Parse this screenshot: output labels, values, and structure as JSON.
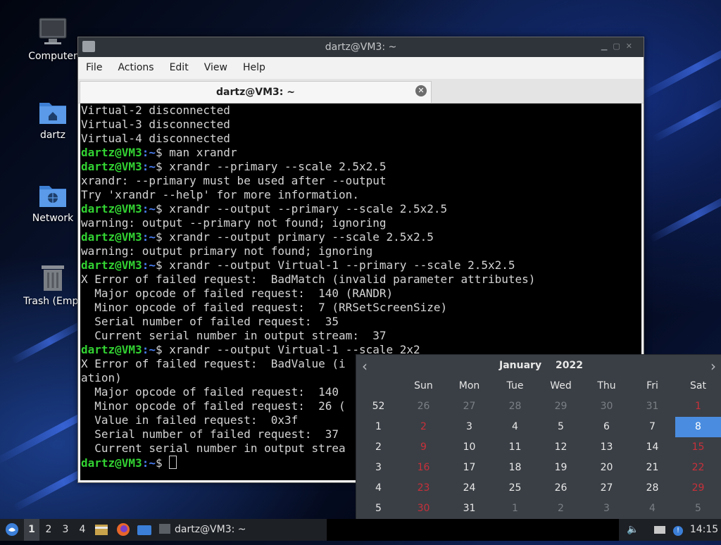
{
  "desktop": {
    "icons": [
      {
        "label": "Computer",
        "icon": "monitor-icon"
      },
      {
        "label": "dartz",
        "icon": "home-folder-icon"
      },
      {
        "label": "Network",
        "icon": "network-folder-icon"
      },
      {
        "label": "Trash (Empt",
        "icon": "trash-icon"
      }
    ]
  },
  "window": {
    "title": "dartz@VM3: ~",
    "menu": [
      "File",
      "Actions",
      "Edit",
      "View",
      "Help"
    ],
    "tab_title": "dartz@VM3: ~"
  },
  "terminal": {
    "prompt_user": "dartz@VM3",
    "prompt_path": ":~",
    "prompt_symbol": "$",
    "lines": [
      {
        "type": "out",
        "text": "Virtual-2 disconnected"
      },
      {
        "type": "out",
        "text": "Virtual-3 disconnected"
      },
      {
        "type": "out",
        "text": "Virtual-4 disconnected"
      },
      {
        "type": "cmd",
        "text": " man xrandr"
      },
      {
        "type": "cmd",
        "text": " xrandr --primary --scale 2.5x2.5"
      },
      {
        "type": "out",
        "text": "xrandr: --primary must be used after --output"
      },
      {
        "type": "out",
        "text": "Try 'xrandr --help' for more information."
      },
      {
        "type": "cmd",
        "text": " xrandr --output --primary --scale 2.5x2.5"
      },
      {
        "type": "out",
        "text": "warning: output --primary not found; ignoring"
      },
      {
        "type": "cmd",
        "text": " xrandr --output primary --scale 2.5x2.5"
      },
      {
        "type": "out",
        "text": "warning: output primary not found; ignoring"
      },
      {
        "type": "cmd",
        "text": " xrandr --output Virtual-1 --primary --scale 2.5x2.5"
      },
      {
        "type": "out",
        "text": "X Error of failed request:  BadMatch (invalid parameter attributes)"
      },
      {
        "type": "out",
        "text": "  Major opcode of failed request:  140 (RANDR)"
      },
      {
        "type": "out",
        "text": "  Minor opcode of failed request:  7 (RRSetScreenSize)"
      },
      {
        "type": "out",
        "text": "  Serial number of failed request:  35"
      },
      {
        "type": "out",
        "text": "  Current serial number in output stream:  37"
      },
      {
        "type": "cmd",
        "text": " xrandr --output Virtual-1 --scale 2x2"
      },
      {
        "type": "out",
        "text": "X Error of failed request:  BadValue (i"
      },
      {
        "type": "out",
        "text": "ation)"
      },
      {
        "type": "out",
        "text": "  Major opcode of failed request:  140"
      },
      {
        "type": "out",
        "text": "  Minor opcode of failed request:  26 ("
      },
      {
        "type": "out",
        "text": "  Value in failed request:  0x3f"
      },
      {
        "type": "out",
        "text": "  Serial number of failed request:  37"
      },
      {
        "type": "out",
        "text": "  Current serial number in output strea"
      },
      {
        "type": "cmd",
        "text": " ",
        "cursor": true
      }
    ]
  },
  "calendar": {
    "month": "January",
    "year": "2022",
    "weekdays": [
      "Sun",
      "Mon",
      "Tue",
      "Wed",
      "Thu",
      "Fri",
      "Sat"
    ],
    "weeks": [
      {
        "week": "52",
        "days": [
          "26",
          "27",
          "28",
          "29",
          "30",
          "31",
          "1"
        ],
        "dim": [
          true,
          true,
          true,
          true,
          true,
          true,
          false
        ]
      },
      {
        "week": "1",
        "days": [
          "2",
          "3",
          "4",
          "5",
          "6",
          "7",
          "8"
        ],
        "dim": [
          false,
          false,
          false,
          false,
          false,
          false,
          false
        ]
      },
      {
        "week": "2",
        "days": [
          "9",
          "10",
          "11",
          "12",
          "13",
          "14",
          "15"
        ],
        "dim": [
          false,
          false,
          false,
          false,
          false,
          false,
          false
        ]
      },
      {
        "week": "3",
        "days": [
          "16",
          "17",
          "18",
          "19",
          "20",
          "21",
          "22"
        ],
        "dim": [
          false,
          false,
          false,
          false,
          false,
          false,
          false
        ]
      },
      {
        "week": "4",
        "days": [
          "23",
          "24",
          "25",
          "26",
          "27",
          "28",
          "29"
        ],
        "dim": [
          false,
          false,
          false,
          false,
          false,
          false,
          false
        ]
      },
      {
        "week": "5",
        "days": [
          "30",
          "31",
          "1",
          "2",
          "3",
          "4",
          "5"
        ],
        "dim": [
          false,
          false,
          true,
          true,
          true,
          true,
          true
        ]
      }
    ],
    "selected_day": "8",
    "colors": {
      "weekend": "#c8303a",
      "selected": "#4a8de0"
    }
  },
  "taskbar": {
    "workspaces": [
      "1",
      "2",
      "3",
      "4"
    ],
    "active_workspace": "1",
    "task_label": "dartz@VM3: ~",
    "clock": "14:15"
  },
  "colors": {
    "prompt_user": "#32d232",
    "prompt_path": "#4a7ff2",
    "terminal_bg": "#000000"
  }
}
